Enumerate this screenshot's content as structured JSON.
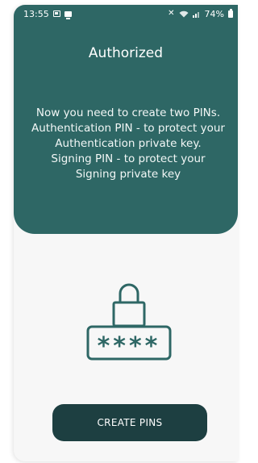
{
  "status_bar": {
    "time": "13:55",
    "battery_percent": "74%",
    "icons": [
      "notification-icon",
      "screen-icon",
      "mute-icon",
      "wifi-icon",
      "signal-icon",
      "battery-icon"
    ]
  },
  "header": {
    "title": "Authorized",
    "description": "Now you need to create two PINs.\nAuthentication PIN - to protect your\nAuthentication private key.\nSigning PIN - to protect your\nSigning private key"
  },
  "illustration": {
    "icon": "pin-lock-icon",
    "pin_mask": "****"
  },
  "actions": {
    "create_pins_label": "CREATE PINS"
  },
  "colors": {
    "primary": "#2e6765",
    "button": "#1d3f41",
    "background": "#f7f7f7"
  }
}
